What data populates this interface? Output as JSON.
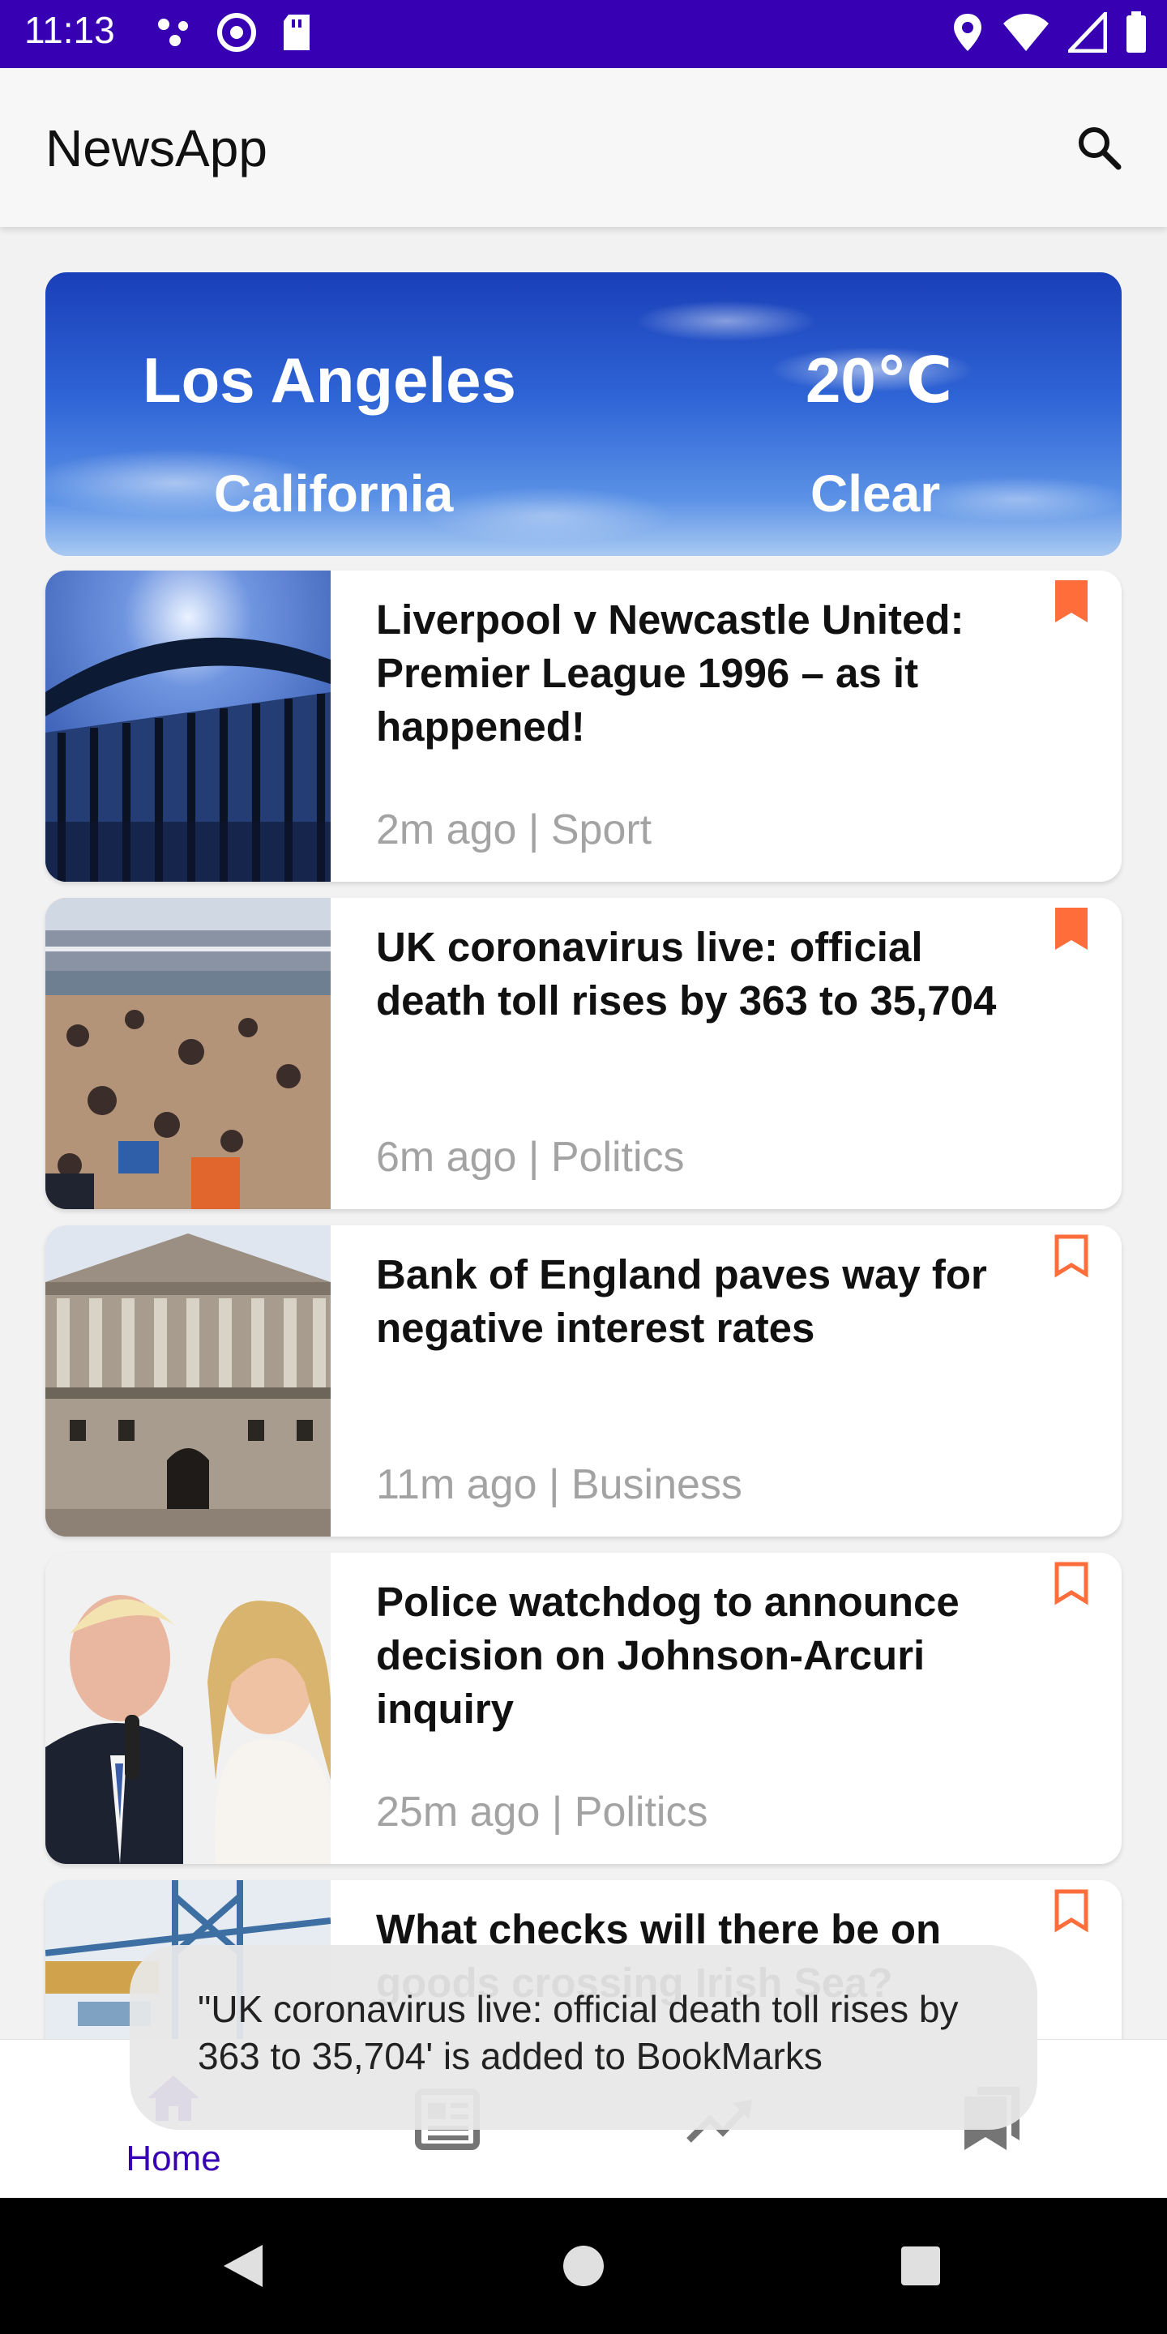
{
  "status_bar": {
    "time": "11:13"
  },
  "app_bar": {
    "title": "NewsApp",
    "search_icon": "search-icon"
  },
  "weather": {
    "city": "Los Angeles",
    "temperature": "20℃",
    "state": "California",
    "condition": "Clear"
  },
  "news": [
    {
      "title": "Liverpool v Newcastle United: Premier League 1996 – as it happened!",
      "meta": "2m ago | Sport",
      "bookmarked": true
    },
    {
      "title": "UK coronavirus live: official death toll rises by 363 to 35,704",
      "meta": "6m ago | Politics",
      "bookmarked": true
    },
    {
      "title": "Bank of England paves way for negative interest rates",
      "meta": "11m ago | Business",
      "bookmarked": false
    },
    {
      "title": "Police watchdog to announce decision on Johnson-Arcuri inquiry",
      "meta": "25m ago | Politics",
      "bookmarked": false
    },
    {
      "title": "What checks will there be on goods crossing Irish Sea?",
      "meta": "",
      "bookmarked": false
    }
  ],
  "bottom_nav": {
    "home_label": "Home",
    "items": [
      "home-icon",
      "newspaper-icon",
      "trending-icon",
      "bookmarks-icon"
    ]
  },
  "toast": {
    "message": "\"UK coronavirus live: official death toll rises by 363 to 35,704' is added to BookMarks"
  },
  "colors": {
    "status_bar": "#3700b3",
    "accent": "#3700b3",
    "bookmark": "#ff6d3a"
  }
}
